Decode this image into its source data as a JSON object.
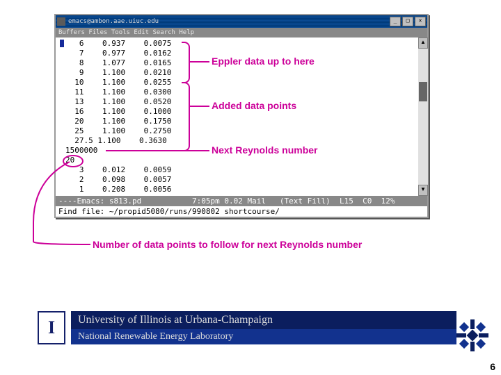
{
  "window": {
    "title": "emacs@ambon.aae.uiuc.edu",
    "btn_min": "_",
    "btn_max": "□",
    "btn_close": "×",
    "menubar": "Buffers Files Tools Edit Search Help",
    "modeline": "----Emacs: s813.pd           7:05pm 0.02 Mail   (Text Fill)  L15  C0  12%",
    "minibuffer": "Find file: ~/propid5080/runs/990802 shortcourse/",
    "sb_up": "▲",
    "sb_down": "▼"
  },
  "editor_lines": [
    "   6    0.937    0.0075",
    "   7    0.977    0.0162",
    "   8    1.077    0.0165",
    "   9    1.100    0.0210",
    "  10    1.100    0.0255",
    "  11    1.100    0.0300",
    "  13    1.100    0.0520",
    "  16    1.100    0.1000",
    "  20    1.100    0.1750",
    "  25    1.100    0.2750",
    "  27.5 1.100    0.3630",
    "1500000",
    "20",
    "   3    0.012    0.0059",
    "   2    0.098    0.0057",
    "   1    0.208    0.0056"
  ],
  "annotations": {
    "eppler": "Eppler data up to here",
    "added": "Added data points",
    "reynolds": "Next Reynolds number",
    "count": "Number of data points to follow for next Reynolds number"
  },
  "footer": {
    "logo": "I",
    "line1": "University of Illinois at Urbana-Champaign",
    "line2": "National Renewable Energy Laboratory"
  },
  "page_number": "6"
}
